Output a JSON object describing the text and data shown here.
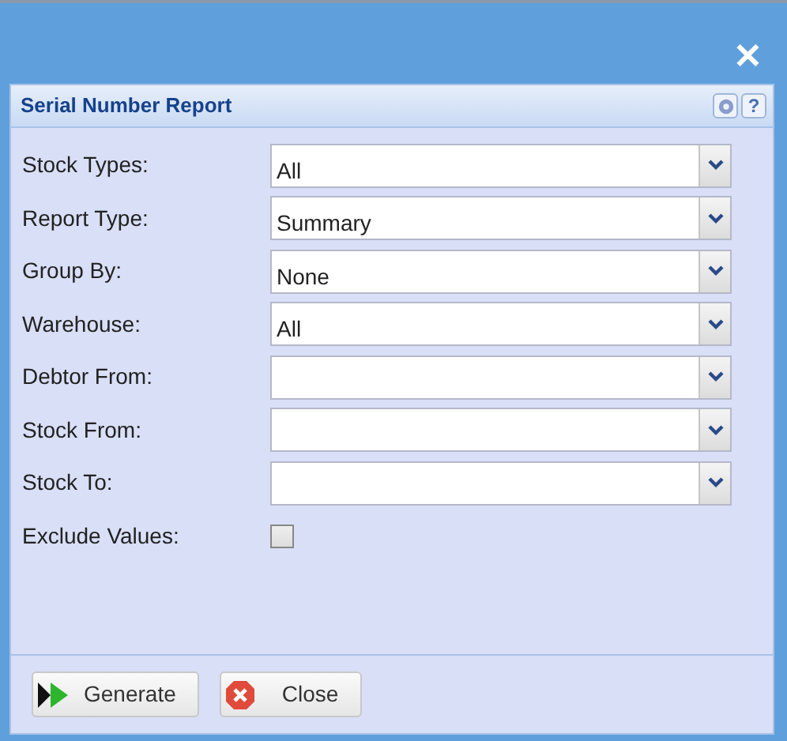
{
  "window": {
    "close_glyph": "✕"
  },
  "panel": {
    "title": "Serial Number Report",
    "help_glyph": "?"
  },
  "fields": [
    {
      "kind": "select",
      "label": "Stock Types:",
      "value": "All"
    },
    {
      "kind": "select",
      "label": "Report Type:",
      "value": "Summary"
    },
    {
      "kind": "select",
      "label": "Group By:",
      "value": "None"
    },
    {
      "kind": "select",
      "label": "Warehouse:",
      "value": "All"
    },
    {
      "kind": "select",
      "label": "Debtor From:"
    },
    {
      "kind": "select",
      "label": "Stock From:"
    },
    {
      "kind": "select",
      "label": "Stock To:"
    },
    {
      "kind": "checkbox",
      "label": "Exclude Values:",
      "checked": false
    }
  ],
  "buttons": [
    {
      "kind": "generate",
      "label": "Generate"
    },
    {
      "kind": "close",
      "label": "Close"
    }
  ]
}
